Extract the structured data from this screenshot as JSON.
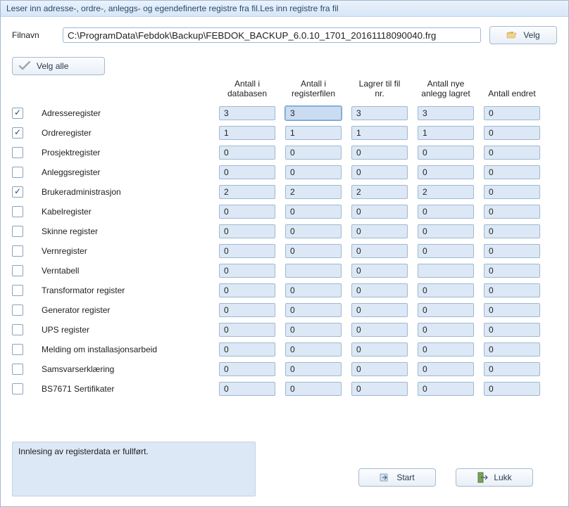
{
  "window": {
    "title": "Leser inn adresse-, ordre-, anleggs- og egendefinerte registre fra fil.Les inn registre fra fil"
  },
  "file": {
    "label": "Filnavn",
    "value": "C:\\ProgramData\\Febdok\\Backup\\FEBDOK_BACKUP_6.0.10_1701_20161118090040.frg",
    "browse_label": "Velg"
  },
  "select_all": {
    "label": "Velg alle"
  },
  "headers": {
    "col1": "Antall i\ndatabasen",
    "col2": "Antall i\nregisterfilen",
    "col3": "Lagrer til fil\nnr.",
    "col4": "Antall nye\nanlegg lagret",
    "col5": "Antall endret"
  },
  "rows": [
    {
      "checked": true,
      "label": "Adresseregister",
      "v": [
        "3",
        "3",
        "3",
        "3",
        "0"
      ],
      "highlight": 1
    },
    {
      "checked": true,
      "label": "Ordreregister",
      "v": [
        "1",
        "1",
        "1",
        "1",
        "0"
      ]
    },
    {
      "checked": false,
      "label": "Prosjektregister",
      "v": [
        "0",
        "0",
        "0",
        "0",
        "0"
      ]
    },
    {
      "checked": false,
      "label": "Anleggsregister",
      "v": [
        "0",
        "0",
        "0",
        "0",
        "0"
      ]
    },
    {
      "checked": true,
      "label": "Brukeradministrasjon",
      "v": [
        "2",
        "2",
        "2",
        "2",
        "0"
      ]
    },
    {
      "checked": false,
      "label": "Kabelregister",
      "v": [
        "0",
        "0",
        "0",
        "0",
        "0"
      ]
    },
    {
      "checked": false,
      "label": "Skinne register",
      "v": [
        "0",
        "0",
        "0",
        "0",
        "0"
      ]
    },
    {
      "checked": false,
      "label": "Vernregister",
      "v": [
        "0",
        "0",
        "0",
        "0",
        "0"
      ]
    },
    {
      "checked": false,
      "label": "Verntabell",
      "v": [
        "0",
        "",
        "0",
        "",
        "0"
      ]
    },
    {
      "checked": false,
      "label": "Transformator register",
      "v": [
        "0",
        "0",
        "0",
        "0",
        "0"
      ]
    },
    {
      "checked": false,
      "label": "Generator register",
      "v": [
        "0",
        "0",
        "0",
        "0",
        "0"
      ]
    },
    {
      "checked": false,
      "label": "UPS register",
      "v": [
        "0",
        "0",
        "0",
        "0",
        "0"
      ]
    },
    {
      "checked": false,
      "label": "Melding om installasjonsarbeid",
      "v": [
        "0",
        "0",
        "0",
        "0",
        "0"
      ]
    },
    {
      "checked": false,
      "label": "Samsvarserklæring",
      "v": [
        "0",
        "0",
        "0",
        "0",
        "0"
      ]
    },
    {
      "checked": false,
      "label": "BS7671 Sertifikater",
      "v": [
        "0",
        "0",
        "0",
        "0",
        "0"
      ]
    }
  ],
  "status": {
    "text": "Innlesing av registerdata er fullført."
  },
  "footer": {
    "start_label": "Start",
    "close_label": "Lukk"
  }
}
